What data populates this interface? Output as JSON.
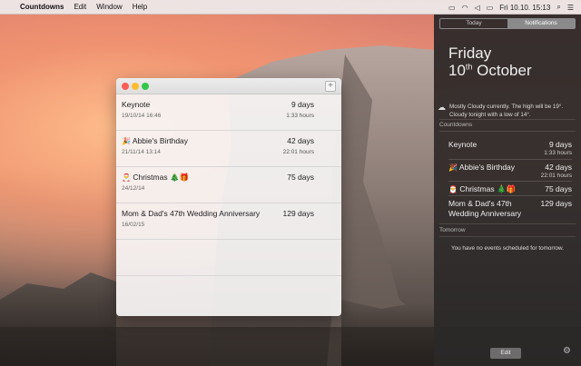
{
  "menubar": {
    "app_name": "Countdowns",
    "items": [
      "Edit",
      "Window",
      "Help"
    ],
    "datetime": "Fri 10.10. 15:13"
  },
  "window": {
    "add_label": "+",
    "rows": [
      {
        "name": "Keynote",
        "icon": "",
        "date": "19/10/14 16:46",
        "days": "9 days",
        "hours": "1:33 hours"
      },
      {
        "name": "Abbie's Birthday",
        "icon": "🎉",
        "date": "21/11/14 13:14",
        "days": "42 days",
        "hours": "22:01 hours"
      },
      {
        "name": "Christmas 🎄🎁",
        "icon": "🎅",
        "date": "24/12/14",
        "days": "75 days",
        "hours": ""
      },
      {
        "name": "Mom & Dad's 47th Wedding Anniversary",
        "icon": "",
        "date": "16/02/15",
        "days": "129 days",
        "hours": ""
      }
    ]
  },
  "notification_center": {
    "tabs": [
      "Today",
      "Notifications"
    ],
    "active_tab": "Notifications",
    "day": "Friday",
    "date_day": "10",
    "date_suffix": "th",
    "date_month": " October",
    "weather": "Mostly Cloudy currently. The high will be 19°. Cloudy tonight with a low of 14°.",
    "countdowns_label": "Countdowns",
    "items": [
      {
        "name": "Keynote",
        "icon": "",
        "days": "9 days",
        "hours": "1:33 hours"
      },
      {
        "name": "Abbie's Birthday",
        "icon": "🎉",
        "days": "42 days",
        "hours": "22:01 hours"
      },
      {
        "name": "Christmas 🎄🎁",
        "icon": "🎅",
        "days": "75 days",
        "hours": ""
      },
      {
        "name": "Mom & Dad's 47th Wedding Anniversary",
        "icon": "",
        "days": "129 days",
        "hours": ""
      }
    ],
    "tomorrow_label": "Tomorrow",
    "no_events": "You have no events scheduled for tomorrow.",
    "edit_label": "Edit"
  }
}
